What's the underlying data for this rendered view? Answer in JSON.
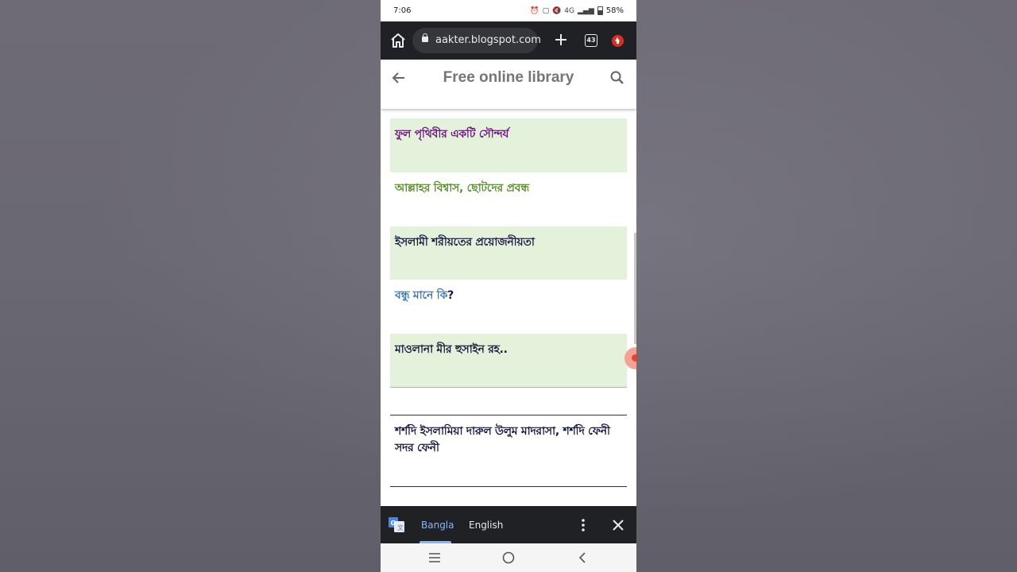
{
  "status_bar": {
    "time": "7:06",
    "network": "4G",
    "battery": "58%"
  },
  "browser": {
    "url": "aakter.blogspot.com",
    "tab_count": "43"
  },
  "blog": {
    "title": "Free online library"
  },
  "posts": [
    {
      "title": "ফুল পৃথিবীর একটি সৌন্দর্য",
      "color": "#6a1b7a"
    },
    {
      "title": "আল্লাহর বিশ্বাস, ছোটদের প্রবন্ধ",
      "color": "#5a8f2e"
    },
    {
      "title": "ইসলামী শরীয়তের প্রয়োজনীয়তা",
      "color": "#1e1e3f"
    },
    {
      "title_link": "বন্ধু মানে কি",
      "title_suffix": "?",
      "color": "#3b7bc0"
    },
    {
      "title": "মাওলানা মীর হুসাইন রহ..",
      "color": "#1a1a40"
    },
    {
      "title": "শর্শদি ইসলামিয়া দারুল উলুম মাদরাসা, শর্শদি ফেনী সদর ফেনী",
      "color": "#1a1a40"
    }
  ],
  "translate_bar": {
    "source_lang": "Bangla",
    "target_lang": "English"
  },
  "colors": {
    "chrome_dark": "#202124",
    "post_green": "#e4f2dc",
    "active_lang": "#8ab4f8"
  }
}
